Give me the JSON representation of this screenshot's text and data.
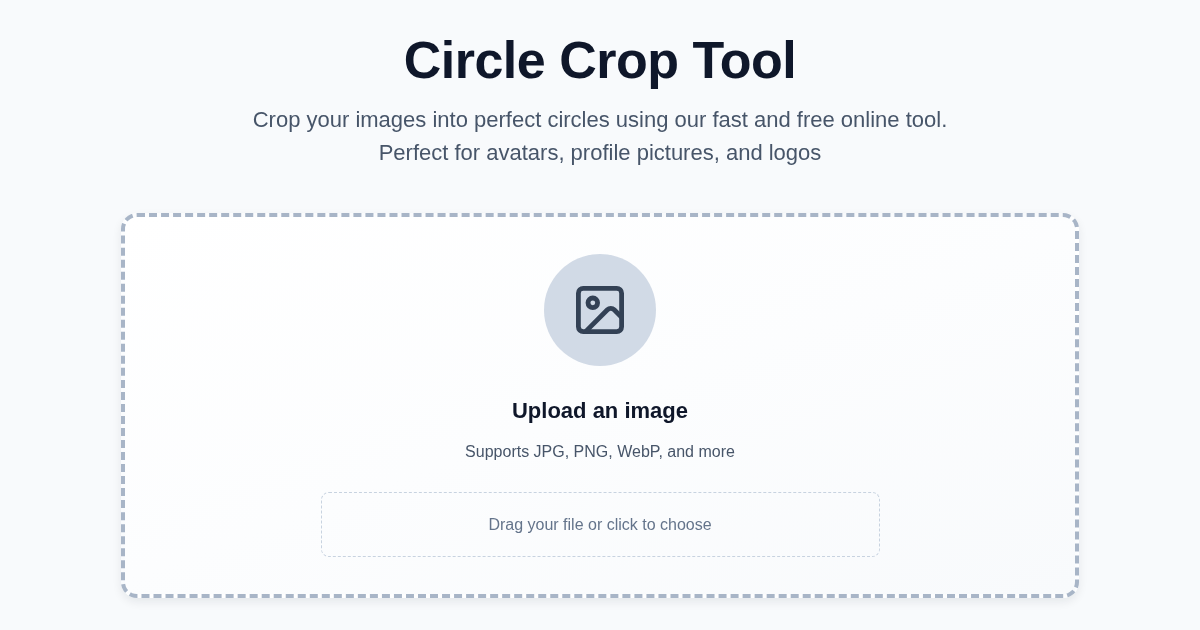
{
  "header": {
    "title": "Circle Crop Tool",
    "subtitle_lines": [
      "Crop your images into perfect circles using our fast and free online tool.",
      "Perfect for avatars, profile pictures, and logos"
    ]
  },
  "upload": {
    "heading": "Upload an image",
    "formats": "Supports JPG, PNG, WebP, and more",
    "drop_prompt": "Drag your file or click to choose"
  }
}
